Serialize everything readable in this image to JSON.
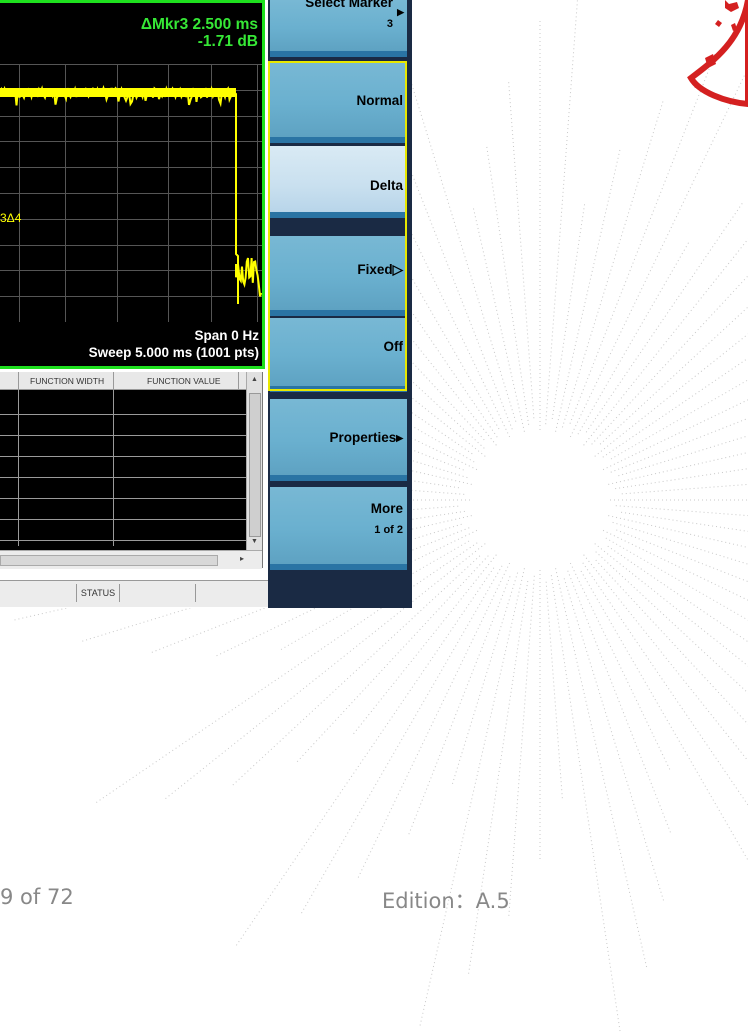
{
  "marker_readout": {
    "line1": "ΔMkr3 2.500 ms",
    "line2": "-1.71 dB"
  },
  "marker_label": "3Δ4",
  "span_info": {
    "span": "Span 0 Hz",
    "sweep": "Sweep  5.000 ms (1001 pts)"
  },
  "function_table": {
    "headers": [
      "FUNCTION WIDTH",
      "FUNCTION VALUE"
    ]
  },
  "status": {
    "label": "STATUS"
  },
  "softkeys": {
    "select_marker": {
      "label": "Select Marker",
      "value": "3"
    },
    "items": [
      {
        "label": "Normal"
      },
      {
        "label": "Delta",
        "active": true
      },
      {
        "label": "Fixed▷"
      },
      {
        "label": "Off"
      },
      {
        "label": "Properties▸"
      },
      {
        "label": "More",
        "sub": "1 of 2"
      }
    ]
  },
  "footer": {
    "page": "9  of  72",
    "edition": "Edition：A.5"
  },
  "colors": {
    "trace": "#ffff00",
    "frame": "#1ee01e",
    "softkey": "#6ab0cf",
    "softkey_active": "#c9e0ef",
    "seal": "#d42020"
  }
}
